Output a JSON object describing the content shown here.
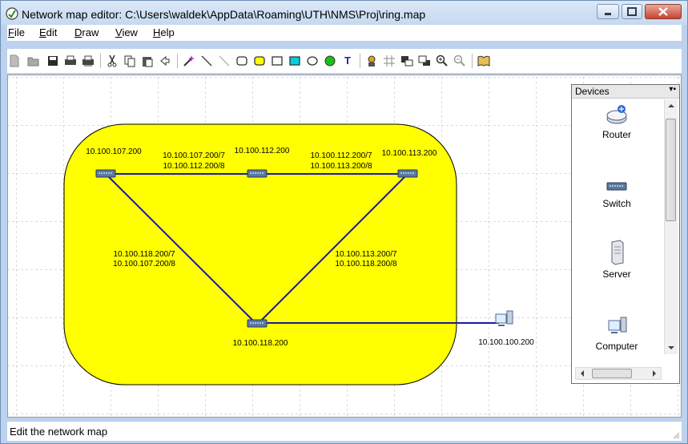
{
  "window": {
    "title": "Network map editor: C:\\Users\\waldek\\AppData\\Roaming\\UTH\\NMS\\Proj\\ring.map"
  },
  "menu": [
    {
      "label": "File",
      "accel": "F",
      "rest": "ile"
    },
    {
      "label": "Edit",
      "accel": "E",
      "rest": "dit"
    },
    {
      "label": "Draw",
      "accel": "D",
      "rest": "raw"
    },
    {
      "label": "View",
      "accel": "V",
      "rest": "iew"
    },
    {
      "label": "Help",
      "accel": "H",
      "rest": "elp"
    }
  ],
  "toolbar": {
    "text_tool_glyph": "T"
  },
  "map": {
    "area_color": "#ffff00",
    "link_color": "#1a1aa0",
    "nodes": {
      "sw_107": {
        "label": "10.100.107.200"
      },
      "sw_112": {
        "label": "10.100.112.200"
      },
      "sw_113": {
        "label": "10.100.113.200"
      },
      "sw_118": {
        "label": "10.100.118.200"
      },
      "pc_100": {
        "label": "10.100.100.200"
      }
    },
    "links": {
      "l_107_112": {
        "line1": "10.100.107.200/7",
        "line2": "10.100.112.200/8"
      },
      "l_112_113": {
        "line1": "10.100.112.200/7",
        "line2": "10.100.113.200/8"
      },
      "l_107_118": {
        "line1": "10.100.118.200/7",
        "line2": "10.100.107.200/8"
      },
      "l_113_118": {
        "line1": "10.100.113.200/7",
        "line2": "10.100.118.200/8"
      }
    }
  },
  "devices_panel": {
    "title": "Devices",
    "items": [
      {
        "label": "Router",
        "icon": "router-icon"
      },
      {
        "label": "Switch",
        "icon": "switch-icon"
      },
      {
        "label": "Server",
        "icon": "server-icon"
      },
      {
        "label": "Computer",
        "icon": "computer-icon"
      }
    ]
  },
  "status": {
    "text": "Edit the network map"
  }
}
